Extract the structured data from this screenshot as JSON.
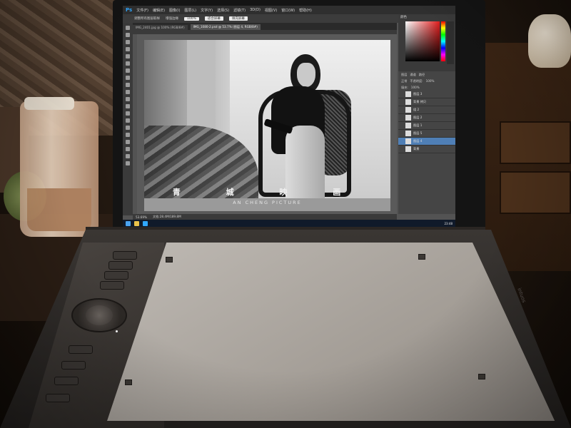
{
  "photoshop": {
    "app_logo": "Ps",
    "menus": [
      "文件(F)",
      "编辑(E)",
      "图像(I)",
      "图层(L)",
      "文字(Y)",
      "选择(S)",
      "滤镜(T)",
      "3D(D)",
      "视图(V)",
      "窗口(W)",
      "帮助(H)"
    ],
    "options": {
      "opt1": "调整所有图层取样",
      "opt2": "增强边缘",
      "zoom": "100%",
      "btn1": "适合屏幕",
      "btn2": "填充屏幕"
    },
    "tabs": [
      "IMG_2401.jpg @ 100% (RGB/8#)",
      "IMG_1080-2.psd @ 53.7% (图层 4, RGB/8#)"
    ],
    "layers_header": [
      "图层",
      "通道",
      "路径"
    ],
    "layers": [
      {
        "name": "图层 3"
      },
      {
        "name": "背景 拷贝"
      },
      {
        "name": "组 2"
      },
      {
        "name": "图层 2"
      },
      {
        "name": "图层 1"
      },
      {
        "name": "图层 5"
      },
      {
        "name": "图层 4"
      },
      {
        "name": "背景"
      }
    ],
    "blend_mode": "正常",
    "opacity_label": "不透明度:",
    "opacity": "100%",
    "fill_label": "填充:",
    "fill": "100%",
    "status": {
      "zoom": "53.69%",
      "doc": "文档:28.4M/189.8M"
    },
    "taskbar_time": "23:48"
  },
  "photo": {
    "title": "青 城 映 画",
    "subtitle": "AN CHENG PICTURE"
  },
  "colors": {
    "ps_blue": "#31a8ff",
    "layer_selected": "#4f7fb6",
    "picker_red": "#e21d1d"
  },
  "tablet": {
    "brand": "intuos"
  }
}
